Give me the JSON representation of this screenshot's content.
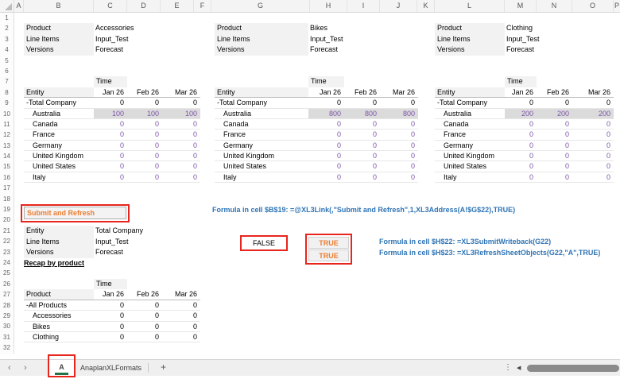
{
  "colors": {
    "annotation_red": "#E8251C",
    "accent_orange": "#ED7D31",
    "formula_blue": "#2E74B5",
    "input_purple": "#7B52A8",
    "active_tab_green": "#217346",
    "highlight_cell_gray": "#DBDBDB",
    "label_cell_gray": "#F2F2F2"
  },
  "grid": {
    "columns": [
      "A",
      "B",
      "C",
      "D",
      "E",
      "F",
      "G",
      "H",
      "I",
      "J",
      "K",
      "L",
      "M",
      "N",
      "O",
      "P"
    ],
    "row_numbers": [
      "1",
      "2",
      "3",
      "4",
      "5",
      "6",
      "7",
      "8",
      "9",
      "10",
      "11",
      "12",
      "13",
      "14",
      "15",
      "16",
      "17",
      "18",
      "19",
      "20",
      "21",
      "22",
      "23",
      "24",
      "25",
      "26",
      "27",
      "28",
      "29",
      "30",
      "31",
      "32"
    ]
  },
  "blocks": [
    {
      "kv": [
        {
          "label": "Product",
          "value": "Accessories"
        },
        {
          "label": "Line Items",
          "value": "Input_Test"
        },
        {
          "label": "Versions",
          "value": "Forecast"
        }
      ],
      "time_label": "Time",
      "entity_label": "Entity",
      "months": [
        "Jan 26",
        "Feb 26",
        "Mar 26"
      ],
      "rows": [
        {
          "label": "-Total Company",
          "values": [
            "0",
            "0",
            "0"
          ],
          "style": "total"
        },
        {
          "label": "Australia",
          "values": [
            "100",
            "100",
            "100"
          ],
          "style": "highlight"
        },
        {
          "label": "Canada",
          "values": [
            "0",
            "0",
            "0"
          ],
          "style": "input"
        },
        {
          "label": "France",
          "values": [
            "0",
            "0",
            "0"
          ],
          "style": "input"
        },
        {
          "label": "Germany",
          "values": [
            "0",
            "0",
            "0"
          ],
          "style": "input"
        },
        {
          "label": "United Kingdom",
          "values": [
            "0",
            "0",
            "0"
          ],
          "style": "input"
        },
        {
          "label": "United States",
          "values": [
            "0",
            "0",
            "0"
          ],
          "style": "input"
        },
        {
          "label": "Italy",
          "values": [
            "0",
            "0",
            "0"
          ],
          "style": "input"
        }
      ]
    },
    {
      "kv": [
        {
          "label": "Product",
          "value": "Bikes"
        },
        {
          "label": "Line Items",
          "value": "Input_Test"
        },
        {
          "label": "Versions",
          "value": "Forecast"
        }
      ],
      "time_label": "Time",
      "entity_label": "Entity",
      "months": [
        "Jan 26",
        "Feb 26",
        "Mar 26"
      ],
      "rows": [
        {
          "label": "-Total Company",
          "values": [
            "0",
            "0",
            "0"
          ],
          "style": "total"
        },
        {
          "label": "Australia",
          "values": [
            "800",
            "800",
            "800"
          ],
          "style": "highlight"
        },
        {
          "label": "Canada",
          "values": [
            "0",
            "0",
            "0"
          ],
          "style": "input"
        },
        {
          "label": "France",
          "values": [
            "0",
            "0",
            "0"
          ],
          "style": "input"
        },
        {
          "label": "Germany",
          "values": [
            "0",
            "0",
            "0"
          ],
          "style": "input"
        },
        {
          "label": "United Kingdom",
          "values": [
            "0",
            "0",
            "0"
          ],
          "style": "input"
        },
        {
          "label": "United States",
          "values": [
            "0",
            "0",
            "0"
          ],
          "style": "input"
        },
        {
          "label": "Italy",
          "values": [
            "0",
            "0",
            "0"
          ],
          "style": "input"
        }
      ]
    },
    {
      "kv": [
        {
          "label": "Product",
          "value": "Clothing"
        },
        {
          "label": "Line Items",
          "value": "Input_Test"
        },
        {
          "label": "Versions",
          "value": "Forecast"
        }
      ],
      "time_label": "Time",
      "entity_label": "Entity",
      "months": [
        "Jan 26",
        "Feb 26",
        "Mar 26"
      ],
      "rows": [
        {
          "label": "-Total Company",
          "values": [
            "0",
            "0",
            "0"
          ],
          "style": "total"
        },
        {
          "label": "Australia",
          "values": [
            "200",
            "200",
            "200"
          ],
          "style": "highlight"
        },
        {
          "label": "Canada",
          "values": [
            "0",
            "0",
            "0"
          ],
          "style": "input"
        },
        {
          "label": "France",
          "values": [
            "0",
            "0",
            "0"
          ],
          "style": "input"
        },
        {
          "label": "Germany",
          "values": [
            "0",
            "0",
            "0"
          ],
          "style": "input"
        },
        {
          "label": "United Kingdom",
          "values": [
            "0",
            "0",
            "0"
          ],
          "style": "input"
        },
        {
          "label": "United States",
          "values": [
            "0",
            "0",
            "0"
          ],
          "style": "input"
        },
        {
          "label": "Italy",
          "values": [
            "0",
            "0",
            "0"
          ],
          "style": "input"
        }
      ]
    }
  ],
  "submit": {
    "button_label": "Submit and Refresh",
    "formula": "Formula in cell  $B$19: =@XL3Link(,\"Submit and Refresh\",1,XL3Address(A!$G$22),TRUE)"
  },
  "recap": {
    "kv": [
      {
        "label": "Entity",
        "value": "Total Company"
      },
      {
        "label": "Line Items",
        "value": "Input_Test"
      },
      {
        "label": "Versions",
        "value": "Forecast"
      }
    ],
    "link_label": "Recap by product"
  },
  "writeback": {
    "false_value": "FALSE",
    "submit_flag": "TRUE",
    "refresh_flag": "TRUE",
    "formula_h22": "Formula in cell  $H$22: =XL3SubmitWriteback(G22)",
    "formula_h23": "Formula in cell  $H$23: =XL3RefreshSheetObjects(G22,\"A\",TRUE)"
  },
  "recap_table": {
    "time_label": "Time",
    "header_label": "Product",
    "months": [
      "Jan 26",
      "Feb 26",
      "Mar 26"
    ],
    "rows": [
      {
        "label": "-All Products",
        "values": [
          "0",
          "0",
          "0"
        ],
        "style": "total"
      },
      {
        "label": "Accessories",
        "values": [
          "0",
          "0",
          "0"
        ],
        "style": "child"
      },
      {
        "label": "Bikes",
        "values": [
          "0",
          "0",
          "0"
        ],
        "style": "child"
      },
      {
        "label": "Clothing",
        "values": [
          "0",
          "0",
          "0"
        ],
        "style": "child"
      }
    ]
  },
  "tabs": {
    "nav_left": "‹",
    "nav_right": "›",
    "active": "A",
    "second": "AnaplanXLFormats",
    "add": "+",
    "more": "⋮",
    "scroll_left": "◀"
  }
}
